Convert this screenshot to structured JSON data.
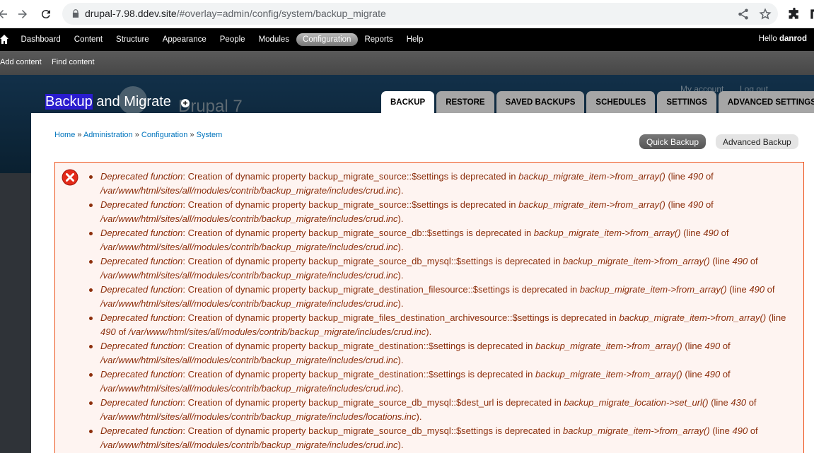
{
  "browser": {
    "url_host": "drupal-7.98.ddev.site",
    "url_path": "/#overlay=admin/config/system/backup_migrate"
  },
  "toolbar": {
    "menu": [
      "Dashboard",
      "Content",
      "Structure",
      "Appearance",
      "People",
      "Modules",
      "Configuration",
      "Reports",
      "Help"
    ],
    "active": "Configuration",
    "hello_prefix": "Hello ",
    "username": "danrod"
  },
  "shortcuts": [
    "Add content",
    "Find content"
  ],
  "background": {
    "site_name": "Drupal 7",
    "my_account": "My account",
    "log_out": "Log out"
  },
  "overlay": {
    "title_highlight": "Backup",
    "title_rest": " and Migrate",
    "tabs": [
      "BACKUP",
      "RESTORE",
      "SAVED BACKUPS",
      "SCHEDULES",
      "SETTINGS",
      "ADVANCED SETTINGS"
    ],
    "active_tab": "BACKUP",
    "breadcrumb": [
      "Home",
      "Administration",
      "Configuration",
      "System"
    ],
    "breadcrumb_sep": " » ",
    "actions": {
      "quick": "Quick Backup",
      "advanced": "Advanced Backup"
    }
  },
  "errors": {
    "items": [
      {
        "label": "Deprecated function",
        "text": ": Creation of dynamic property backup_migrate_source::$settings is deprecated in ",
        "func": "backup_migrate_item->from_array()",
        "line_pre": " (line ",
        "line": "490",
        "of": " of ",
        "file": "/var/www/html/sites/all/modules/contrib/backup_migrate/includes/crud.inc",
        "end": ")."
      },
      {
        "label": "Deprecated function",
        "text": ": Creation of dynamic property backup_migrate_source::$settings is deprecated in ",
        "func": "backup_migrate_item->from_array()",
        "line_pre": " (line ",
        "line": "490",
        "of": " of ",
        "file": "/var/www/html/sites/all/modules/contrib/backup_migrate/includes/crud.inc",
        "end": ")."
      },
      {
        "label": "Deprecated function",
        "text": ": Creation of dynamic property backup_migrate_source_db::$settings is deprecated in ",
        "func": "backup_migrate_item->from_array()",
        "line_pre": " (line ",
        "line": "490",
        "of": " of ",
        "file": "/var/www/html/sites/all/modules/contrib/backup_migrate/includes/crud.inc",
        "end": ")."
      },
      {
        "label": "Deprecated function",
        "text": ": Creation of dynamic property backup_migrate_source_db_mysql::$settings is deprecated in ",
        "func": "backup_migrate_item->from_array()",
        "line_pre": " (line ",
        "line": "490",
        "of": " of ",
        "file": "/var/www/html/sites/all/modules/contrib/backup_migrate/includes/crud.inc",
        "end": ")."
      },
      {
        "label": "Deprecated function",
        "text": ": Creation of dynamic property backup_migrate_destination_filesource::$settings is deprecated in ",
        "func": "backup_migrate_item->from_array()",
        "line_pre": " (line ",
        "line": "490",
        "of": " of ",
        "file": "/var/www/html/sites/all/modules/contrib/backup_migrate/includes/crud.inc",
        "end": ")."
      },
      {
        "label": "Deprecated function",
        "text": ": Creation of dynamic property backup_migrate_files_destination_archivesource::$settings is deprecated in ",
        "func": "backup_migrate_item->from_array()",
        "line_pre": " (line ",
        "line": "490",
        "of": " of ",
        "file": "/var/www/html/sites/all/modules/contrib/backup_migrate/includes/crud.inc",
        "end": ")."
      },
      {
        "label": "Deprecated function",
        "text": ": Creation of dynamic property backup_migrate_destination::$settings is deprecated in ",
        "func": "backup_migrate_item->from_array()",
        "line_pre": " (line ",
        "line": "490",
        "of": " of ",
        "file": "/var/www/html/sites/all/modules/contrib/backup_migrate/includes/crud.inc",
        "end": ")."
      },
      {
        "label": "Deprecated function",
        "text": ": Creation of dynamic property backup_migrate_destination::$settings is deprecated in ",
        "func": "backup_migrate_item->from_array()",
        "line_pre": " (line ",
        "line": "490",
        "of": " of ",
        "file": "/var/www/html/sites/all/modules/contrib/backup_migrate/includes/crud.inc",
        "end": ")."
      },
      {
        "label": "Deprecated function",
        "text": ": Creation of dynamic property backup_migrate_source_db_mysql::$dest_url is deprecated in ",
        "func": "backup_migrate_location->set_url()",
        "line_pre": " (line ",
        "line": "430",
        "of": " of ",
        "file": "/var/www/html/sites/all/modules/contrib/backup_migrate/includes/locations.inc",
        "end": ")."
      },
      {
        "label": "Deprecated function",
        "text": ": Creation of dynamic property backup_migrate_source_db_mysql::$settings is deprecated in ",
        "func": "backup_migrate_item->from_array()",
        "line_pre": " (line ",
        "line": "490",
        "of": " of ",
        "file": "/var/www/html/sites/all/modules/contrib/backup_migrate/includes/crud.inc",
        "end": ")."
      }
    ]
  }
}
